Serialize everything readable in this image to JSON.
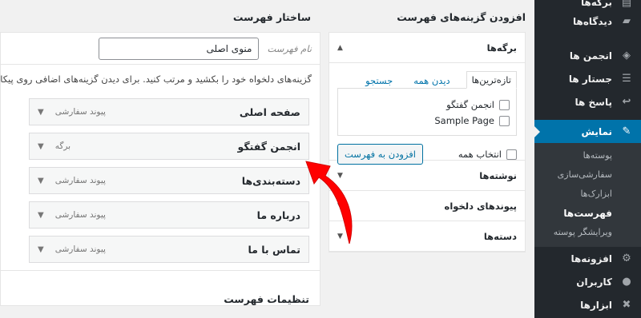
{
  "sidebar": {
    "items_top": [
      {
        "label": "برگه‌ها",
        "icon": "pages-icon"
      },
      {
        "label": "دیدگاه‌ها",
        "icon": "comments-icon"
      }
    ],
    "items_mid": [
      {
        "label": "انجمن ها",
        "icon": "forums-icon"
      },
      {
        "label": "جستار ها",
        "icon": "topics-icon"
      },
      {
        "label": "پاسخ ها",
        "icon": "replies-icon"
      }
    ],
    "active": {
      "label": "نمایش",
      "icon": "appearance-icon"
    },
    "submenu": [
      "پوسته‌ها",
      "سفارشی‌سازی",
      "ابزارک‌ها",
      "فهرست‌ها",
      "ویرایشگر پوسته"
    ],
    "submenu_current_index": 3,
    "items_bottom": [
      {
        "label": "افزونه‌ها",
        "icon": "plugins-icon"
      },
      {
        "label": "کاربران",
        "icon": "users-icon"
      },
      {
        "label": "ابزارها",
        "icon": "tools-icon"
      }
    ],
    "colors": {
      "bg": "#23282d",
      "active": "#0073aa"
    }
  },
  "add_items": {
    "heading": "افزودن گزینه‌های فهرست",
    "pages_title": "برگه‌ها",
    "tabs": [
      "تازه‌ترین‌ها",
      "دیدن همه",
      "جستجو"
    ],
    "pages": [
      "انجمن گفتگو",
      "Sample Page"
    ],
    "select_all": "انتخاب همه",
    "add_button": "افزودن به فهرست",
    "sections": [
      "نوشته‌ها",
      "پیوندهای دلخواه",
      "دسته‌ها"
    ]
  },
  "structure": {
    "heading": "ساختار فهرست",
    "name_label": "نام فهرست",
    "name_value": "منوی اصلی",
    "hint": "گزینه‌های دلخواه خود را بکشید و مرتب کنید. برای دیدن گزینه‌های اضافی روی پیکان کنا",
    "items": [
      {
        "title": "صفحه اصلی",
        "type": "پیوند سفارشی"
      },
      {
        "title": "انجمن گفتگو",
        "type": "برگه"
      },
      {
        "title": "دسته‌بندی‌ها",
        "type": "پیوند سفارشی"
      },
      {
        "title": "درباره ما",
        "type": "پیوند سفارشی"
      },
      {
        "title": "تماس با ما",
        "type": "پیوند سفارشی"
      }
    ],
    "settings_heading": "تنظیمات فهرست"
  }
}
